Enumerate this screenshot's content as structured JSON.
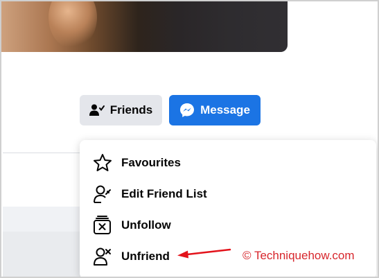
{
  "profile": {
    "friends_button": {
      "label": "Friends",
      "icon": "person-check-icon"
    },
    "message_button": {
      "label": "Message",
      "icon": "messenger-icon"
    }
  },
  "dropdown": {
    "items": [
      {
        "label": "Favourites",
        "icon": "star-icon"
      },
      {
        "label": "Edit Friend List",
        "icon": "person-edit-icon"
      },
      {
        "label": "Unfollow",
        "icon": "unfollow-box-icon"
      },
      {
        "label": "Unfriend",
        "icon": "person-remove-icon"
      }
    ]
  },
  "annotation": {
    "watermark": "© Techniquehow.com",
    "arrow_color": "#e3131b"
  },
  "colors": {
    "message_blue": "#1b74e4",
    "button_grey": "#e4e6eb",
    "watermark_red": "#d7262c"
  }
}
